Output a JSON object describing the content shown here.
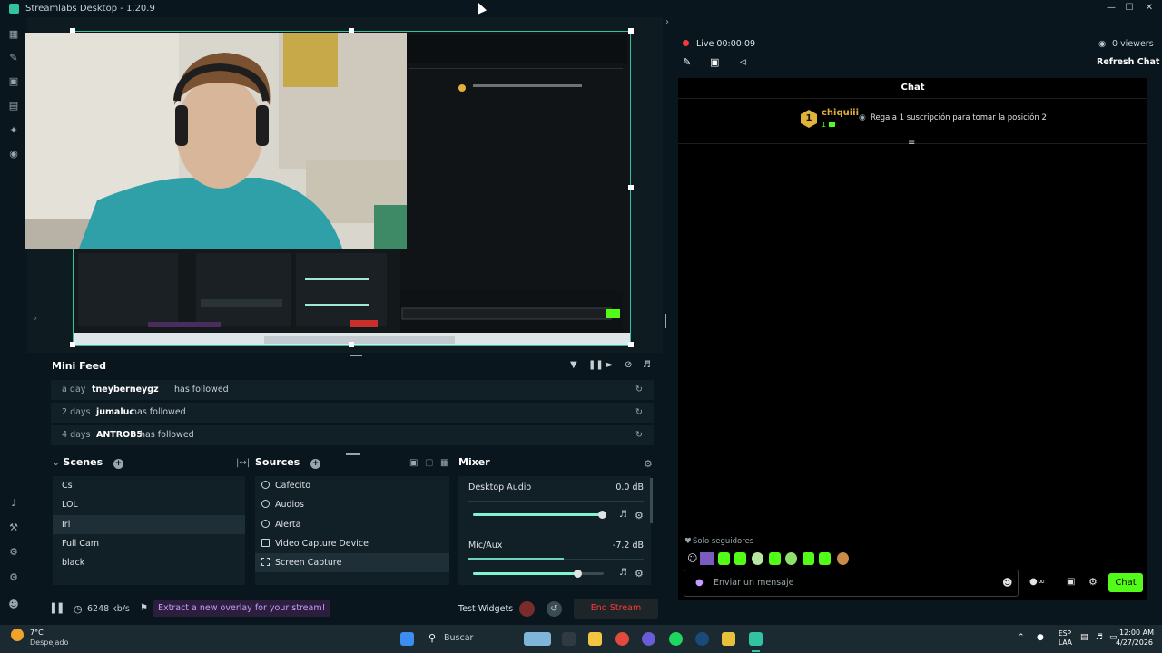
{
  "window": {
    "title": "Streamlabs Desktop - 1.20.9"
  },
  "stream_info": {
    "live_label": "Live 00:00:09",
    "viewers": "0 viewers",
    "refresh_chat": "Refresh Chat"
  },
  "chat": {
    "header": "Chat",
    "message": {
      "badge": "1",
      "user": "chiquiii",
      "sub": "1",
      "text": "Regala 1 suscripción para tomar la posición 2"
    },
    "followers_only": "Solo seguidores",
    "input_placeholder": "Enviar un mensaje",
    "send_label": "Chat"
  },
  "minifeed": {
    "title": "Mini Feed",
    "items": [
      {
        "time": "a day",
        "user": "tneyberneygz",
        "action": "has followed"
      },
      {
        "time": "2 days",
        "user": "jumaluc",
        "action": "has followed"
      },
      {
        "time": "4 days",
        "user": "ANTROB5",
        "action": "has followed"
      }
    ]
  },
  "scenes": {
    "title": "Scenes",
    "items": [
      "Cs",
      "LOL",
      "Irl",
      "Full Cam",
      "black"
    ],
    "selected": "Irl"
  },
  "sources": {
    "title": "Sources",
    "items": [
      "Cafecito",
      "Audios",
      "Alerta",
      "Video Capture Device",
      "Screen Capture"
    ],
    "selected": "Screen Capture"
  },
  "mixer": {
    "title": "Mixer",
    "channels": [
      {
        "name": "Desktop Audio",
        "db": "0.0 dB",
        "level": 1.0
      },
      {
        "name": "Mic/Aux",
        "db": "-7.2 dB",
        "level": 0.8
      }
    ]
  },
  "footer": {
    "bitrate": "6248 kb/s",
    "promo": "Extract a new overlay for your stream!",
    "test_widgets": "Test Widgets",
    "end_stream": "End Stream"
  },
  "taskbar": {
    "weather_temp": "7°C",
    "weather_desc": "Despejado",
    "search": "Buscar",
    "lang1": "ESP",
    "lang2": "LAA",
    "time": "12:00 AM",
    "date": "4/27/2026"
  },
  "colors": {
    "accent": "#31c3a2",
    "live": "#f53b3b",
    "slider": "#80f5d2",
    "chat_send": "#53fc18"
  },
  "icons": [
    "pencil-icon",
    "camera-icon",
    "share-icon",
    "eye-icon",
    "filter-icon",
    "pause-icon",
    "skip-icon",
    "mute-icon",
    "volume-icon",
    "gear-icon",
    "add-icon",
    "replay-icon"
  ]
}
